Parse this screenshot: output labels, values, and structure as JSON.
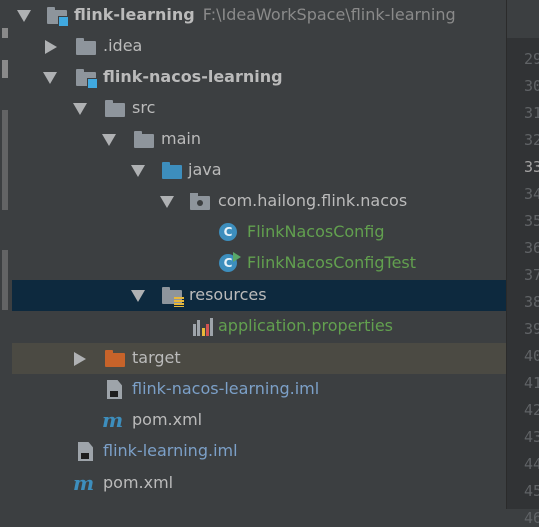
{
  "project_tree": {
    "root": {
      "label": "flink-learning",
      "path": "F:\\IdeaWorkSpace\\flink-learning"
    },
    "idea": {
      "label": ".idea"
    },
    "module": {
      "label": "flink-nacos-learning"
    },
    "src": {
      "label": "src"
    },
    "main": {
      "label": "main"
    },
    "java": {
      "label": "java"
    },
    "package": {
      "label": "com.hailong.flink.nacos"
    },
    "class1": {
      "label": "FlinkNacosConfig"
    },
    "class2": {
      "label": "FlinkNacosConfigTest"
    },
    "resources": {
      "label": "resources"
    },
    "properties": {
      "label": "application.properties"
    },
    "target": {
      "label": "target"
    },
    "module_iml": {
      "label": "flink-nacos-learning.iml"
    },
    "module_pom": {
      "label": "pom.xml"
    },
    "root_iml": {
      "label": "flink-learning.iml"
    },
    "root_pom": {
      "label": "pom.xml"
    }
  },
  "gutter": {
    "lines": [
      "29",
      "30",
      "31",
      "32",
      "33",
      "34",
      "35",
      "36",
      "37",
      "38",
      "39",
      "40",
      "41",
      "42",
      "43",
      "44",
      "45",
      "46"
    ],
    "current": "33"
  },
  "colors": {
    "background": "#3c3f41",
    "selection": "#0d293e",
    "hover": "#4b4a43",
    "folder": "#8e959c",
    "source_folder": "#3d8ebd",
    "excluded_folder": "#c7632a",
    "class_text": "#62a04f",
    "iml_text": "#7ca0c8"
  },
  "icons": {
    "folder": "folder-icon",
    "module": "module-folder-icon",
    "package": "package-icon",
    "class": "java-class-icon",
    "test": "test-class-icon",
    "resources": "resources-folder-icon",
    "properties": "properties-file-icon",
    "iml": "iml-file-icon",
    "maven": "maven-icon"
  }
}
